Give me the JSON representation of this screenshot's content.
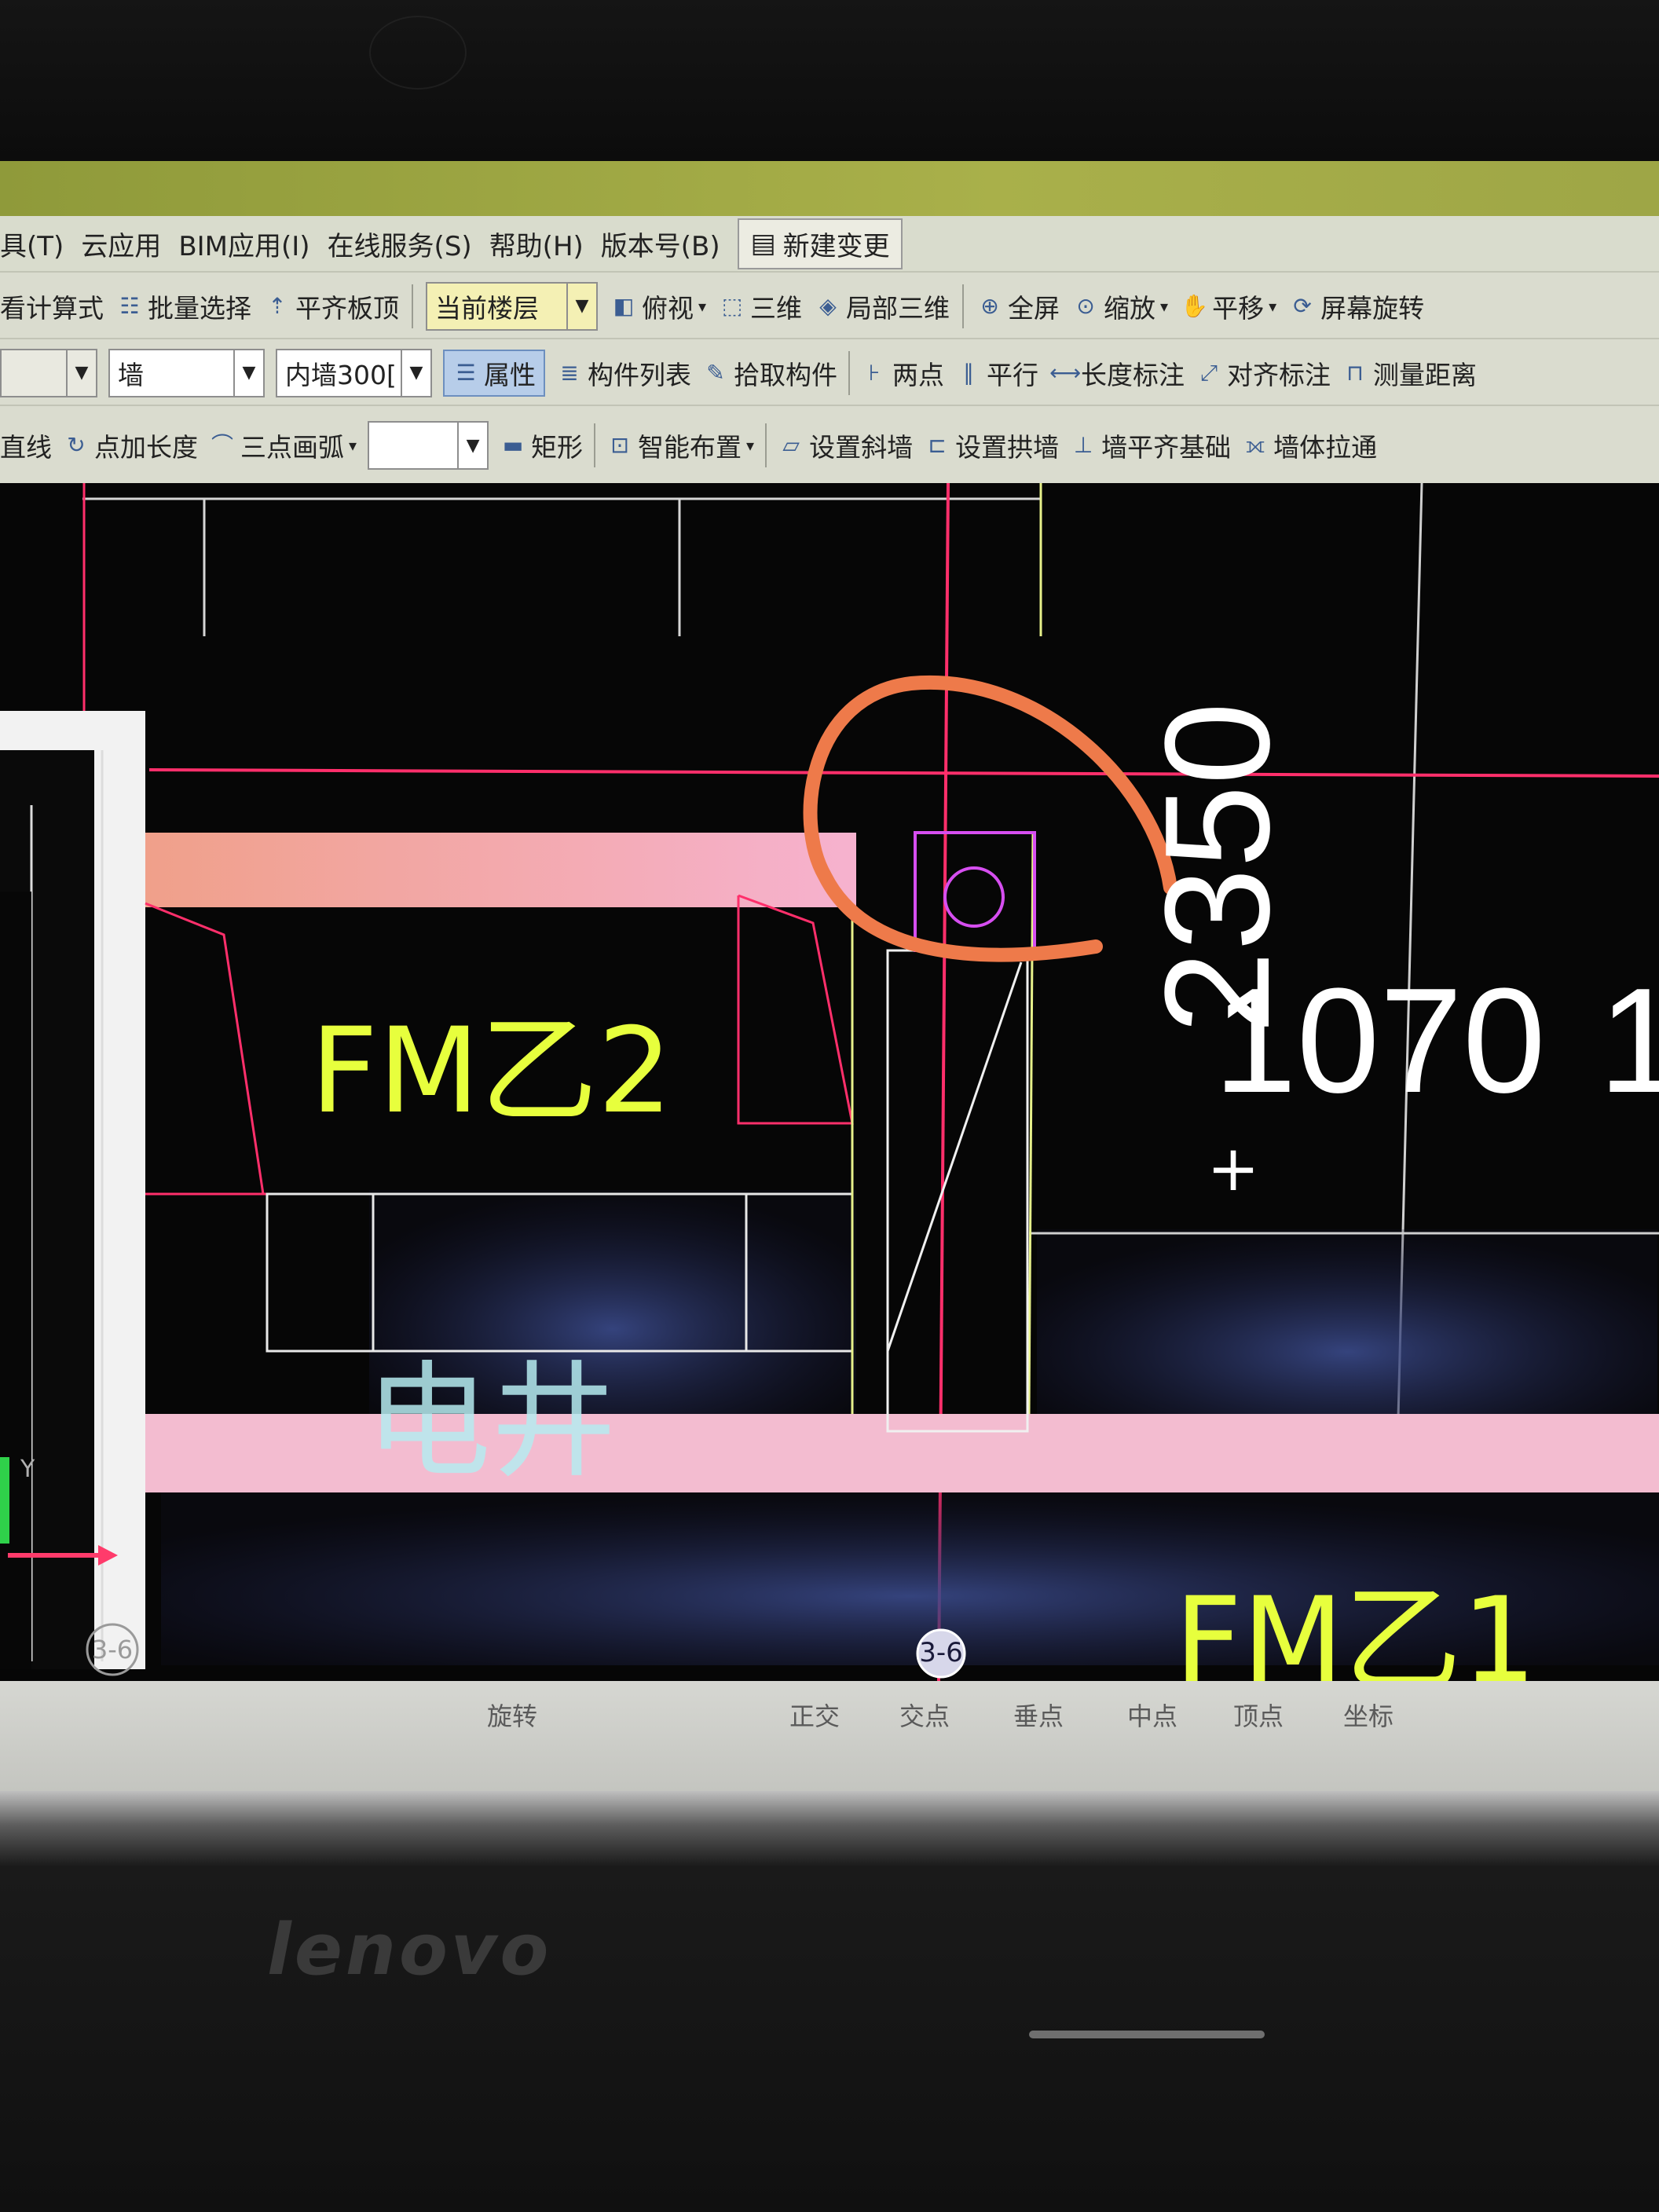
{
  "menu": {
    "items": [
      "具(T)",
      "云应用",
      "BIM应用(I)",
      "在线服务(S)",
      "帮助(H)",
      "版本号(B)"
    ],
    "new_change": "新建变更"
  },
  "toolbar1": {
    "calc": "看计算式",
    "batch_select": "批量选择",
    "align_top": "平齐板顶",
    "current_floor": "当前楼层",
    "top_view": "俯视",
    "three_d": "三维",
    "local_3d": "局部三维",
    "fullscreen": "全屏",
    "zoom": "缩放",
    "pan": "平移",
    "screen_rotate": "屏幕旋转"
  },
  "toolbar2": {
    "type_select": "墙",
    "name_select": "内墙300[",
    "attributes": "属性",
    "component_list": "构件列表",
    "pick_component": "拾取构件",
    "two_points": "两点",
    "parallel": "平行",
    "length_dim": "长度标注",
    "align_dim": "对齐标注",
    "measure_distance": "测量距离"
  },
  "toolbar3": {
    "line": "直线",
    "point_length": "点加长度",
    "three_point_arc": "三点画弧",
    "rectangle": "矩形",
    "smart_layout": "智能布置",
    "set_slope_wall": "设置斜墙",
    "set_arch_wall": "设置拱墙",
    "wall_align_base": "墙平齐基础",
    "wall_stretch": "墙体拉通"
  },
  "canvas": {
    "dim_vertical": "2350",
    "dim_horizontal": "1070",
    "dim_horizontal_cut": "1",
    "door_label": "FMZ2",
    "door_label_display": "FM乙2",
    "room_label": "电井",
    "door_label_bottom": "FM乙1",
    "axis_marker_center": "3-6",
    "axis_marker_left": "3-6",
    "axis_y": "Y",
    "crosshair": "+"
  },
  "statusbar": {
    "items": [
      "旋转",
      "正交",
      "交点",
      "垂点",
      "中点",
      "顶点",
      "坐标"
    ]
  },
  "colors": {
    "canvas_bg": "#060606",
    "axis_line": "#ff2f6b",
    "wall_fill": "#f3a8bf",
    "outline_yellow": "#e6f08a",
    "label_yellow": "#e7ff3d",
    "annotation_orange": "#ee7a4a",
    "circle_magenta": "#d64ef0"
  },
  "brand": "lenovo"
}
